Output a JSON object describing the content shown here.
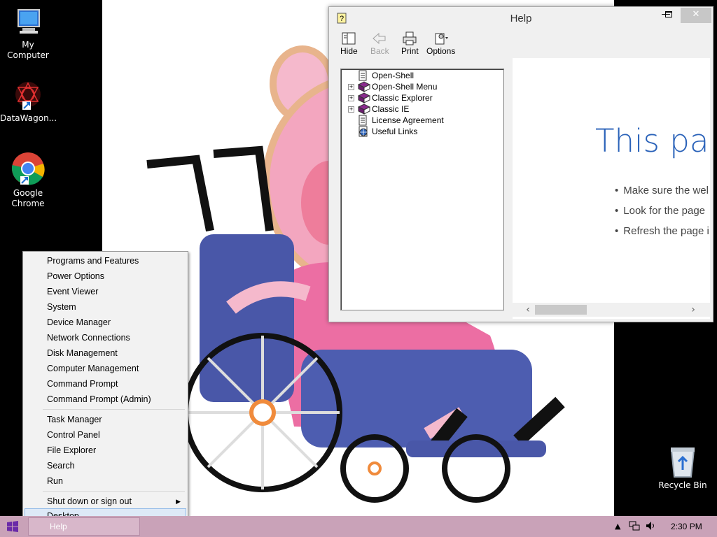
{
  "desktop": {
    "icons": [
      {
        "label": "My Computer"
      },
      {
        "label": "DataWagon..."
      },
      {
        "label": "Google Chrome"
      },
      {
        "label": "Recycle Bin"
      }
    ]
  },
  "help_window": {
    "title": "Help",
    "toolbar": {
      "hide": "Hide",
      "back": "Back",
      "print": "Print",
      "options": "Options"
    },
    "tree": [
      {
        "label": "Open-Shell",
        "icon": "page-icon",
        "expandable": false
      },
      {
        "label": "Open-Shell Menu",
        "icon": "book-icon",
        "expandable": true
      },
      {
        "label": "Classic Explorer",
        "icon": "book-icon",
        "expandable": true
      },
      {
        "label": "Classic IE",
        "icon": "book-icon",
        "expandable": true
      },
      {
        "label": "License Agreement",
        "icon": "page-icon",
        "expandable": false
      },
      {
        "label": "Useful Links",
        "icon": "globe-page-icon",
        "expandable": false
      }
    ],
    "content": {
      "heading": "This pag",
      "bullets": [
        "Make sure the wel",
        "Look for the page",
        "Refresh the page i"
      ]
    }
  },
  "context_menu": {
    "items": [
      "Programs and Features",
      "Power Options",
      "Event Viewer",
      "System",
      "Device Manager",
      "Network Connections",
      "Disk Management",
      "Computer Management",
      "Command Prompt",
      "Command Prompt (Admin)",
      "Task Manager",
      "Control Panel",
      "File Explorer",
      "Search",
      "Run",
      "Shut down or sign out",
      "Desktop"
    ],
    "highlighted": "Desktop"
  },
  "taskbar": {
    "task_help": "Help",
    "clock": "2:30 PM",
    "color": "#c9a2b8"
  }
}
